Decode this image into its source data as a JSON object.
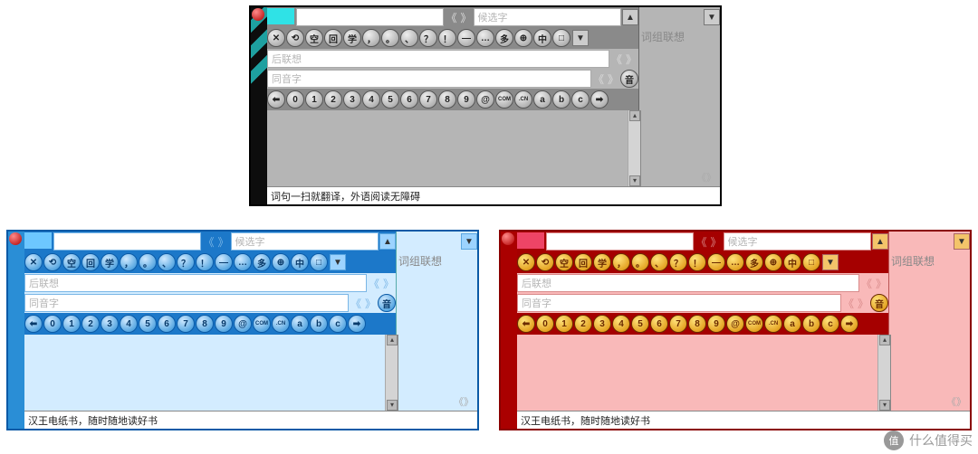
{
  "labels": {
    "candidate": "候选字",
    "assoc": "后联想",
    "homophone": "同音字",
    "phrase_assoc": "词组联想",
    "sound_btn": "音"
  },
  "toolbar1": [
    "✕",
    "⟲",
    "空",
    "回",
    "学",
    "，",
    "。",
    "、",
    "？",
    "！",
    "—",
    "…",
    "多",
    "⊕",
    "中",
    "□"
  ],
  "numrow_pre": "⬅",
  "numrow": [
    "0",
    "1",
    "2",
    "3",
    "4",
    "5",
    "6",
    "7",
    "8",
    "9",
    "@",
    "COM",
    ".CN",
    "a",
    "b",
    "c"
  ],
  "numrow_post": "➡",
  "chev_l": "《",
  "chev_r": "》",
  "arrow_up": "▲",
  "arrow_dn": "▼",
  "footers": {
    "dark": "词句一扫就翻译，外语阅读无障碍",
    "blue": "汉王电纸书，随时随地读好书",
    "red": "汉王电纸书，随时随地读好书"
  },
  "watermark": {
    "badge": "值",
    "text": "什么值得买"
  }
}
